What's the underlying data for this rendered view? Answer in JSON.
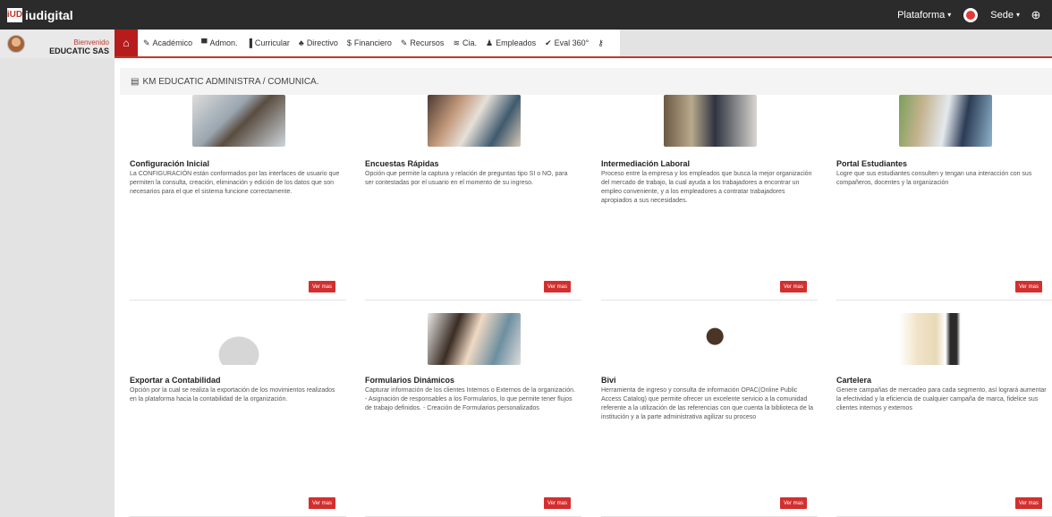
{
  "brand": {
    "logo_mark": "iUD",
    "name": "iudigital"
  },
  "top_right": {
    "platform": "Plataforma",
    "sede": "Sede"
  },
  "user": {
    "welcome": "Bienvenido",
    "company": "EDUCATIC SAS"
  },
  "nav": {
    "items": [
      {
        "label": "Académico",
        "icon": "pencil-icon",
        "glyph": "✎"
      },
      {
        "label": "Admon.",
        "icon": "briefcase-icon",
        "glyph": "▀"
      },
      {
        "label": "Curricular",
        "icon": "book-icon",
        "glyph": "▐"
      },
      {
        "label": "Directivo",
        "icon": "users-icon",
        "glyph": "♣"
      },
      {
        "label": "Financiero",
        "icon": "dollar-icon",
        "glyph": "$"
      },
      {
        "label": "Recursos",
        "icon": "wrench-icon",
        "glyph": "✎"
      },
      {
        "label": "Cia.",
        "icon": "database-icon",
        "glyph": "≋"
      },
      {
        "label": "Empleados",
        "icon": "employees-icon",
        "glyph": "♟"
      },
      {
        "label": "Eval 360°",
        "icon": "check-circle-icon",
        "glyph": "✔"
      },
      {
        "label": "",
        "icon": "key-icon",
        "glyph": "⚷"
      }
    ]
  },
  "section": {
    "title": "KM EDUCATIC ADMINISTRA / COMUNICA."
  },
  "button_label": "Ver mas",
  "cards": [
    {
      "title": "Configuración Inicial",
      "desc": "La CONFIGURACIÓN están conformados por las interfaces de usuario que permiten la consulta, creación, eliminación y edición de los datos que son necesarios para el que el sistema funcione correctamente."
    },
    {
      "title": "Encuestas Rápidas",
      "desc": "Opción que permite la captura y relación de preguntas tipo SI o NO, para ser contestadas por el usuario en el momento de su ingreso."
    },
    {
      "title": "Intermediación Laboral",
      "desc": "Proceso entre la empresa y los empleados que busca la mejor organización del mercado de trabajo, la cual ayuda a los trabajadores a encontrar un empleo conveniente, y a los empleadores a contratar trabajadores apropiados a sus necesidades."
    },
    {
      "title": "Portal Estudiantes",
      "desc": "Logre que sus estudiantes consulten y tengan una interacción con sus compañeros, docentes y la organización"
    },
    {
      "title": "Exportar a Contabilidad",
      "desc": "Opción por la cual se realiza la exportación de los movimientos realizados en la plataforma hacia la contabilidad de la organización."
    },
    {
      "title": "Formularios Dinámicos",
      "desc": "Capturar información de los clientes Internos o Externos de la organización. - Asignación de responsables a los Formularios, lo que permite tener flujos de trabajo definidos. - Creación de Formularios personalizados"
    },
    {
      "title": "Bivi",
      "desc": "Herramienta de ingreso y consulta de información OPAC(Online Public Access Catalog) que permite ofrecer un excelente servicio a la comunidad referente a la utilización de las referencias con que cuenta la biblioteca de la institución y a la parte administrativa agilizar su proceso"
    },
    {
      "title": "Cartelera",
      "desc": "Genere campañas de mercadeo para cada segmento, así logrará aumentar la efectividad y la eficiencia de cualquier campaña de marca, fidelice sus clientes internos y externos"
    }
  ]
}
